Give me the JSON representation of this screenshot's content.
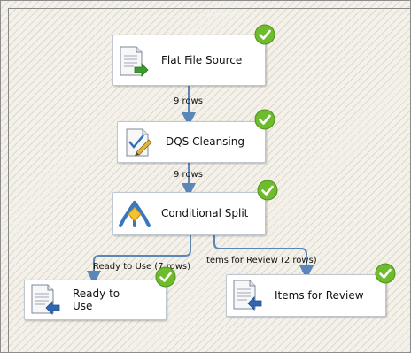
{
  "colors": {
    "canvas_background": "#f4f1ea",
    "connector": "#5b86b8",
    "success_badge": "#6fbb2e"
  },
  "tasks": {
    "flat_file_source": {
      "label": "Flat File Source",
      "icon": "flat-file-source-icon",
      "status": "success-check-icon"
    },
    "dqs_cleansing": {
      "label": "DQS Cleansing",
      "icon": "dqs-cleansing-icon",
      "status": "success-check-icon"
    },
    "conditional_split": {
      "label": "Conditional Split",
      "icon": "conditional-split-icon",
      "status": "success-check-icon"
    },
    "ready_to_use": {
      "label": "Ready to\nUse",
      "icon": "destination-icon",
      "status": "success-check-icon"
    },
    "items_for_review": {
      "label": "Items for Review",
      "icon": "destination-icon",
      "status": "success-check-icon"
    }
  },
  "flows": {
    "source_to_cleansing": "9 rows",
    "cleansing_to_split": "9 rows",
    "split_to_ready": "Ready to Use (7 rows)",
    "split_to_review": "Items for Review (2 rows)"
  }
}
